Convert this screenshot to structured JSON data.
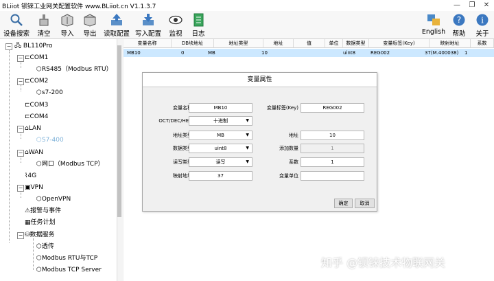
{
  "window": {
    "title": "BLiiot  钡铼工业网关配置软件 www.BLiiot.cn V1.1.3.7",
    "minimize": "—",
    "restore": "❐",
    "close": "✕"
  },
  "toolbar": {
    "left": [
      "设备搜索",
      "清空",
      "导入",
      "导出",
      "读取配置",
      "写入配置",
      "监视",
      "日志"
    ],
    "right": [
      "English",
      "帮助",
      "关于"
    ]
  },
  "tree": {
    "root": "BL110Pro",
    "com1": "COM1",
    "rs485": "RS485（Modbus RTU）",
    "com2": "COM2",
    "s7_200": "s7-200",
    "com3": "COM3",
    "com4": "COM4",
    "lan": "LAN",
    "s7_400": "S7-400",
    "wan": "WAN",
    "netport": "网口（Modbus TCP）",
    "g4": "4G",
    "vpn": "VPN",
    "openvpn": "OpenVPN",
    "alarm": "报警与事件",
    "task": "任务计划",
    "dataservice": "数据服务",
    "passthrough": "透传",
    "rtu_tcp": "Modbus RTU与TCP",
    "tcp_server": "Modbus TCP Server"
  },
  "table": {
    "headers": [
      "变量名称",
      "DB块地址",
      "地址类型",
      "地址",
      "值",
      "单位",
      "数据类型",
      "变量标签(Key)",
      "映射地址",
      "系数"
    ],
    "row": [
      "MB10",
      "0",
      "MB",
      "10",
      "",
      "",
      "uint8",
      "REG002",
      "37(M.400038)",
      "1"
    ]
  },
  "dialog": {
    "title": "变量属性",
    "name_label": "变量名称",
    "name_value": "MB10",
    "key_label": "变量标签(Key)",
    "key_value": "REG002",
    "radix_label": "OCT/DEC/HEX",
    "radix_value": "十进制",
    "addrtype_label": "地址类型",
    "addrtype_value": "MB",
    "addr_label": "地址",
    "addr_value": "10",
    "datatype_label": "数据类型",
    "datatype_value": "uint8",
    "count_label": "添加数量",
    "count_value": "1",
    "rw_label": "读写类型",
    "rw_value": "读写",
    "coef_label": "系数",
    "coef_value": "1",
    "map_label": "映射地址",
    "map_value": "37",
    "unit_label": "变量单位",
    "unit_value": "",
    "ok": "确定",
    "cancel": "取消"
  },
  "watermark": "知乎 @钡铼技术物联网关",
  "colors": {
    "selected_row": "#cce8ff",
    "selected_node": "#7fb2d9"
  }
}
